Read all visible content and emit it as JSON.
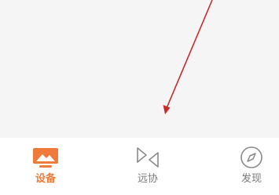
{
  "tabbar": {
    "active_tab": "devices",
    "accent_color": "#f07a3a",
    "inactive_color": "#8a8a8a",
    "tabs": [
      {
        "id": "devices",
        "label": "设备",
        "icon": "device-image-icon"
      },
      {
        "id": "remote",
        "label": "远协",
        "icon": "remote-assist-icon"
      },
      {
        "id": "discover",
        "label": "发现",
        "icon": "compass-icon"
      }
    ]
  },
  "annotation": {
    "arrow_color": "#cc2a2a"
  }
}
